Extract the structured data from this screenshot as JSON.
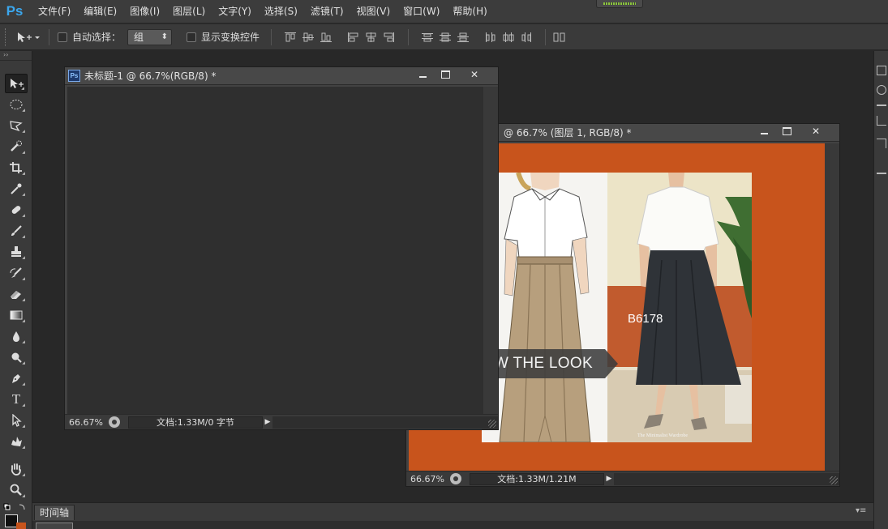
{
  "app": {
    "logo": "Ps",
    "menu": [
      "文件(F)",
      "编辑(E)",
      "图像(I)",
      "图层(L)",
      "文字(Y)",
      "选择(S)",
      "滤镜(T)",
      "视图(V)",
      "窗口(W)",
      "帮助(H)"
    ]
  },
  "options": {
    "auto_select_label": "自动选择：",
    "auto_select_value": "组",
    "show_transform_label": "显示变换控件"
  },
  "tools": [
    "move-tool-icon",
    "elliptical-marquee-icon",
    "polygonal-lasso-icon",
    "quick-selection-icon",
    "crop-icon",
    "eyedropper-icon",
    "healing-brush-icon",
    "brush-icon",
    "clone-stamp-icon",
    "history-brush-icon",
    "eraser-icon",
    "gradient-icon",
    "blur-icon",
    "dodge-icon",
    "pen-icon",
    "type-icon",
    "path-selection-icon",
    "custom-shape-icon",
    "hand-icon",
    "zoom-icon"
  ],
  "type_tool_glyph": "T",
  "doc1": {
    "title": "未标题-1 @ 66.7%(RGB/8) *",
    "zoom": "66.67%",
    "info": "文档:1.33M/0 字节"
  },
  "doc2": {
    "title": "@ 66.7% (图层 1, RGB/8) *",
    "zoom": "66.67%",
    "info": "文档:1.33M/1.21M",
    "banner": "EW THE LOOK",
    "code": "B6178",
    "credit": "The Minimalist Wardrobe"
  },
  "timeline": {
    "tab": "时间轴"
  },
  "colors": {
    "bg": "#282828",
    "canvas_orange": "#c8541c",
    "accent_blue": "#3ba7ee"
  }
}
